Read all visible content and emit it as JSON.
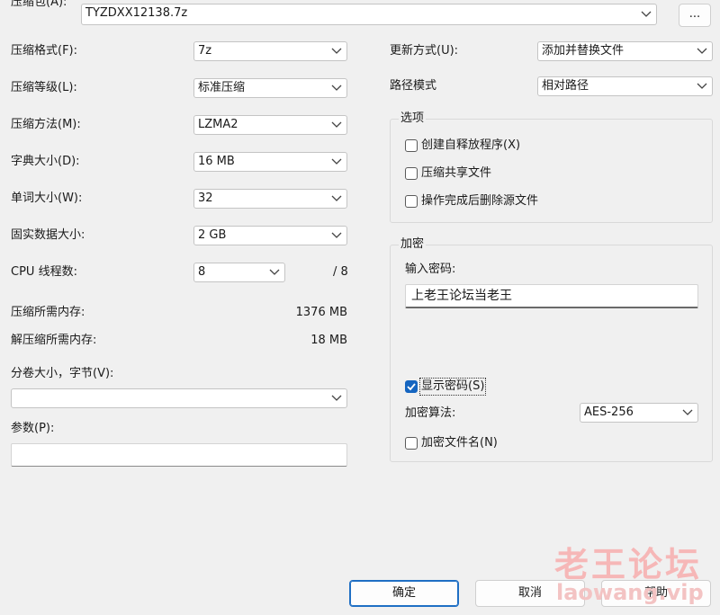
{
  "archive": {
    "label": "压缩包(A):",
    "path": "TYZDXX12138.7z",
    "browse_label": "..."
  },
  "left": {
    "format": {
      "label": "压缩格式(F):",
      "value": "7z"
    },
    "level": {
      "label": "压缩等级(L):",
      "value": "标准压缩"
    },
    "method": {
      "label": "压缩方法(M):",
      "value": "LZMA2"
    },
    "dict": {
      "label": "字典大小(D):",
      "value": "16 MB"
    },
    "word": {
      "label": "单词大小(W):",
      "value": "32"
    },
    "solid": {
      "label": "固实数据大小:",
      "value": "2 GB"
    },
    "threads": {
      "label": "CPU 线程数:",
      "value": "8",
      "max": "/ 8"
    },
    "mem_compress": {
      "label": "压缩所需内存:",
      "value": "1376 MB"
    },
    "mem_decompress": {
      "label": "解压缩所需内存:",
      "value": "18 MB"
    },
    "split": {
      "label": "分卷大小，字节(V):",
      "value": ""
    },
    "params": {
      "label": "参数(P):",
      "value": ""
    }
  },
  "right": {
    "update": {
      "label": "更新方式(U):",
      "value": "添加并替换文件"
    },
    "pathmode": {
      "label": "路径模式",
      "value": "相对路径"
    },
    "options": {
      "title": "选项",
      "sfx": "创建自释放程序(X)",
      "shared": "压缩共享文件",
      "delete": "操作完成后删除源文件"
    },
    "encryption": {
      "title": "加密",
      "password_label": "输入密码:",
      "password": "上老王论坛当老王",
      "show_password": "显示密码(S)",
      "method_label": "加密算法:",
      "method": "AES-256",
      "encrypt_names": "加密文件名(N)"
    }
  },
  "buttons": {
    "ok": "确定",
    "cancel": "取消",
    "help": "帮助"
  },
  "watermark": {
    "line1": "老王论坛",
    "line2": "laowang.vip"
  },
  "colors": {
    "accent": "#1565c0",
    "watermark": "#f6b7b7"
  }
}
